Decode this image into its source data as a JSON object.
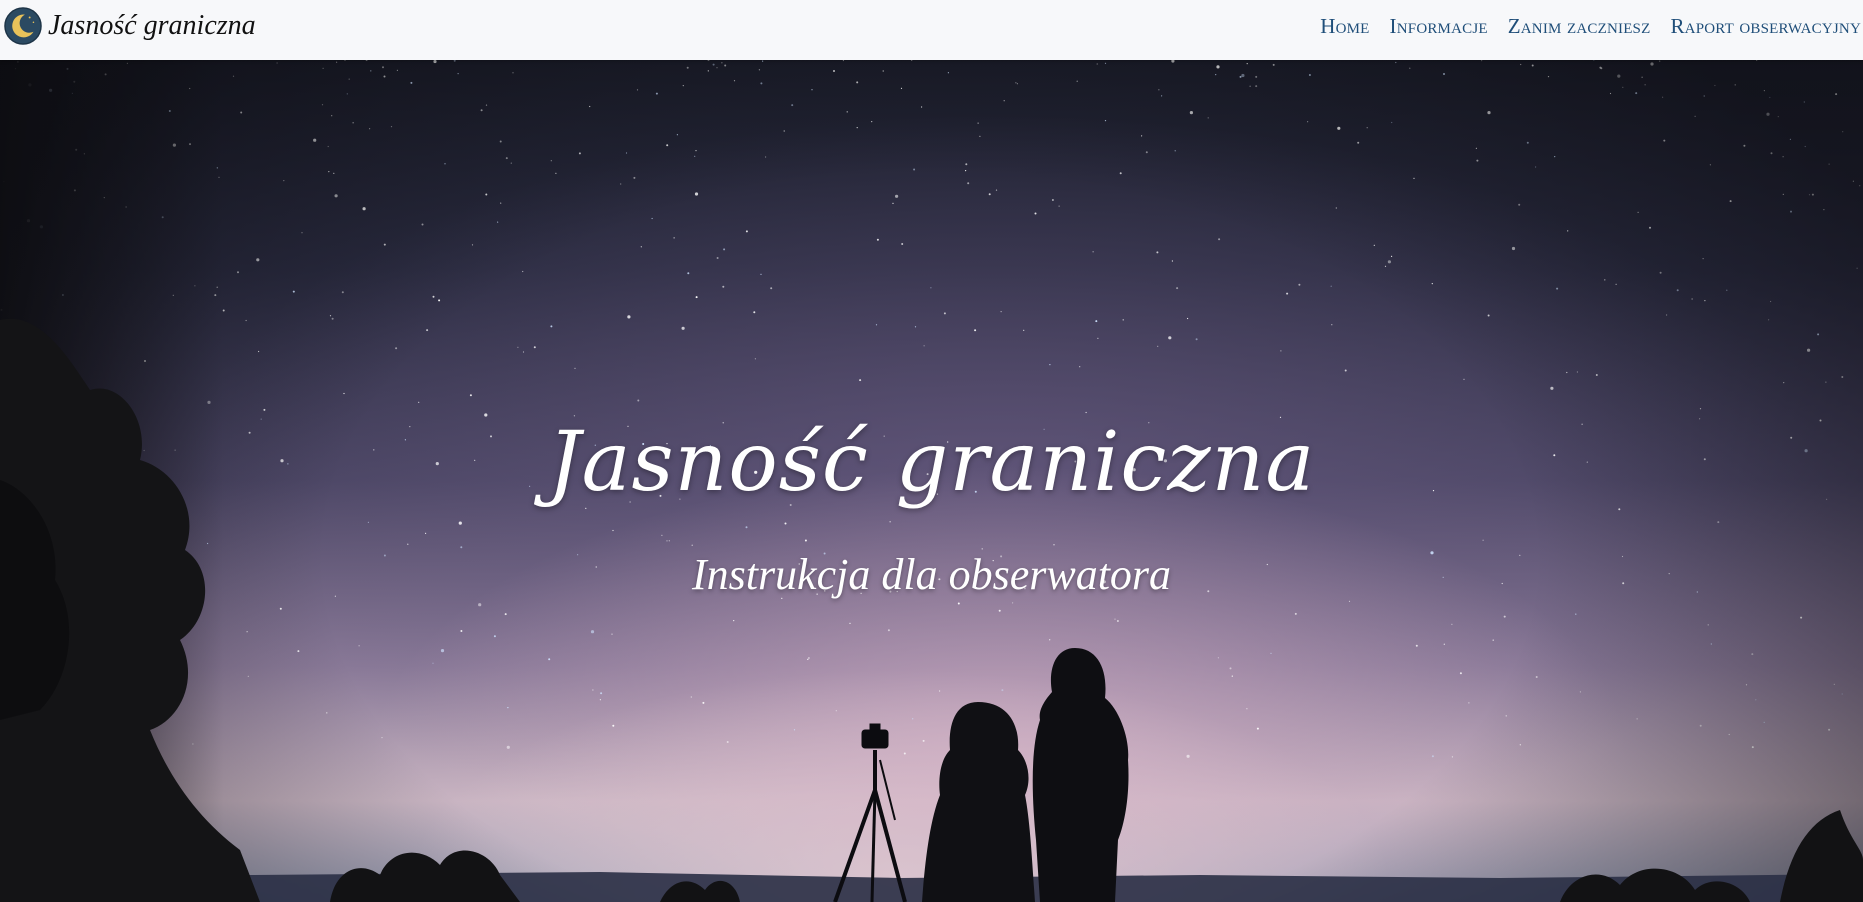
{
  "navbar": {
    "brand_icon": "crescent-moon-icon",
    "brand_text": "Jasność graniczna",
    "links": [
      "Home",
      "Informacje",
      "Zanim zaczniesz",
      "Raport obserwacyjny"
    ],
    "link_color": "#1f4e79",
    "background": "#f7f8fa"
  },
  "hero": {
    "title": "Jasność graniczna",
    "subtitle": "Instrukcja dla obserwatora",
    "background_scene": "night-sky-stargazers-image"
  }
}
